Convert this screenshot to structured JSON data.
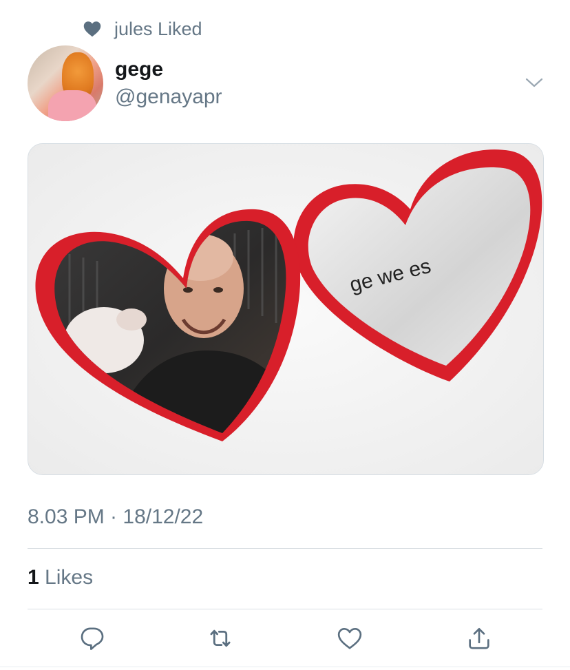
{
  "social_context": {
    "icon": "heart-filled-icon",
    "text": "jules Liked"
  },
  "tweet": {
    "display_name": "gege",
    "handle": "@genayapr",
    "menu_icon": "chevron-down-icon",
    "media": {
      "caption_text": "ge we es"
    },
    "timestamp": "8.03 PM · 18/12/22",
    "likes_count": "1",
    "likes_label": "Likes"
  },
  "actions": [
    {
      "name": "reply",
      "icon": "reply-icon"
    },
    {
      "name": "retweet",
      "icon": "retweet-icon"
    },
    {
      "name": "like",
      "icon": "heart-outline-icon"
    },
    {
      "name": "share",
      "icon": "share-icon"
    }
  ],
  "colors": {
    "secondary_text": "#657786",
    "primary_text": "#14171a",
    "divider": "#d9dee2",
    "locket_red": "#d81f2a"
  }
}
